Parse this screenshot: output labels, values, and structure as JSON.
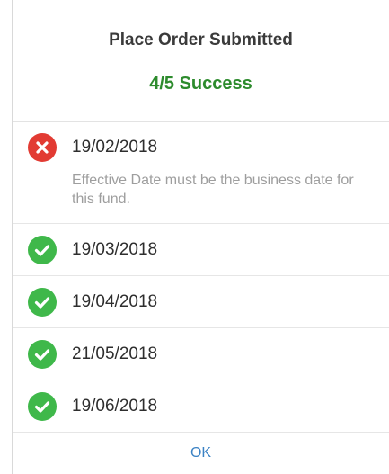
{
  "dialog": {
    "title": "Place Order Submitted",
    "summary": "4/5 Success",
    "ok_label": "OK"
  },
  "results": [
    {
      "status": "error",
      "icon": "error-x-icon",
      "date": "19/02/2018",
      "message": "Effective Date must be the business date for this fund."
    },
    {
      "status": "success",
      "icon": "success-check-icon",
      "date": "19/03/2018"
    },
    {
      "status": "success",
      "icon": "success-check-icon",
      "date": "19/04/2018"
    },
    {
      "status": "success",
      "icon": "success-check-icon",
      "date": "21/05/2018"
    },
    {
      "status": "success",
      "icon": "success-check-icon",
      "date": "19/06/2018"
    }
  ],
  "colors": {
    "success": "#3fb84a",
    "error": "#e23b33",
    "summary_text": "#2d8b2d",
    "link": "#3b82c4"
  }
}
